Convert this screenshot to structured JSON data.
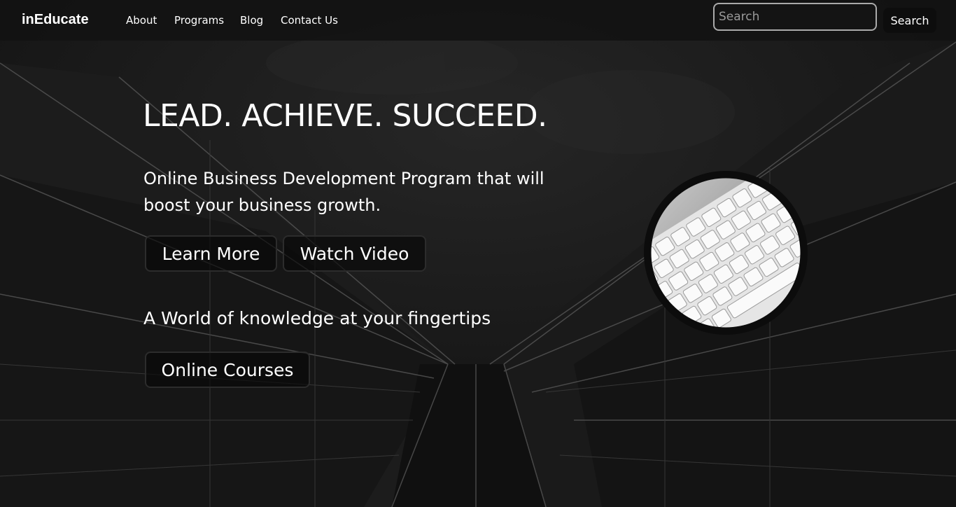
{
  "brand": {
    "name": "inEducate"
  },
  "nav": {
    "items": [
      {
        "label": "About"
      },
      {
        "label": "Programs"
      },
      {
        "label": "Blog"
      },
      {
        "label": "Contact Us"
      }
    ]
  },
  "search": {
    "placeholder": "Search",
    "button_label": "Search"
  },
  "hero": {
    "headline": "LEAD. ACHIEVE. SUCCEED.",
    "tagline": "Online Business Development Program that will boost your business growth.",
    "learn_more_label": "Learn More",
    "watch_video_label": "Watch Video",
    "subheadline": "A World of knowledge at your fingertips",
    "courses_label": "Online Courses"
  },
  "icons": {
    "hero_image": "keyboard-photo",
    "background": "skyscraper-photo"
  }
}
